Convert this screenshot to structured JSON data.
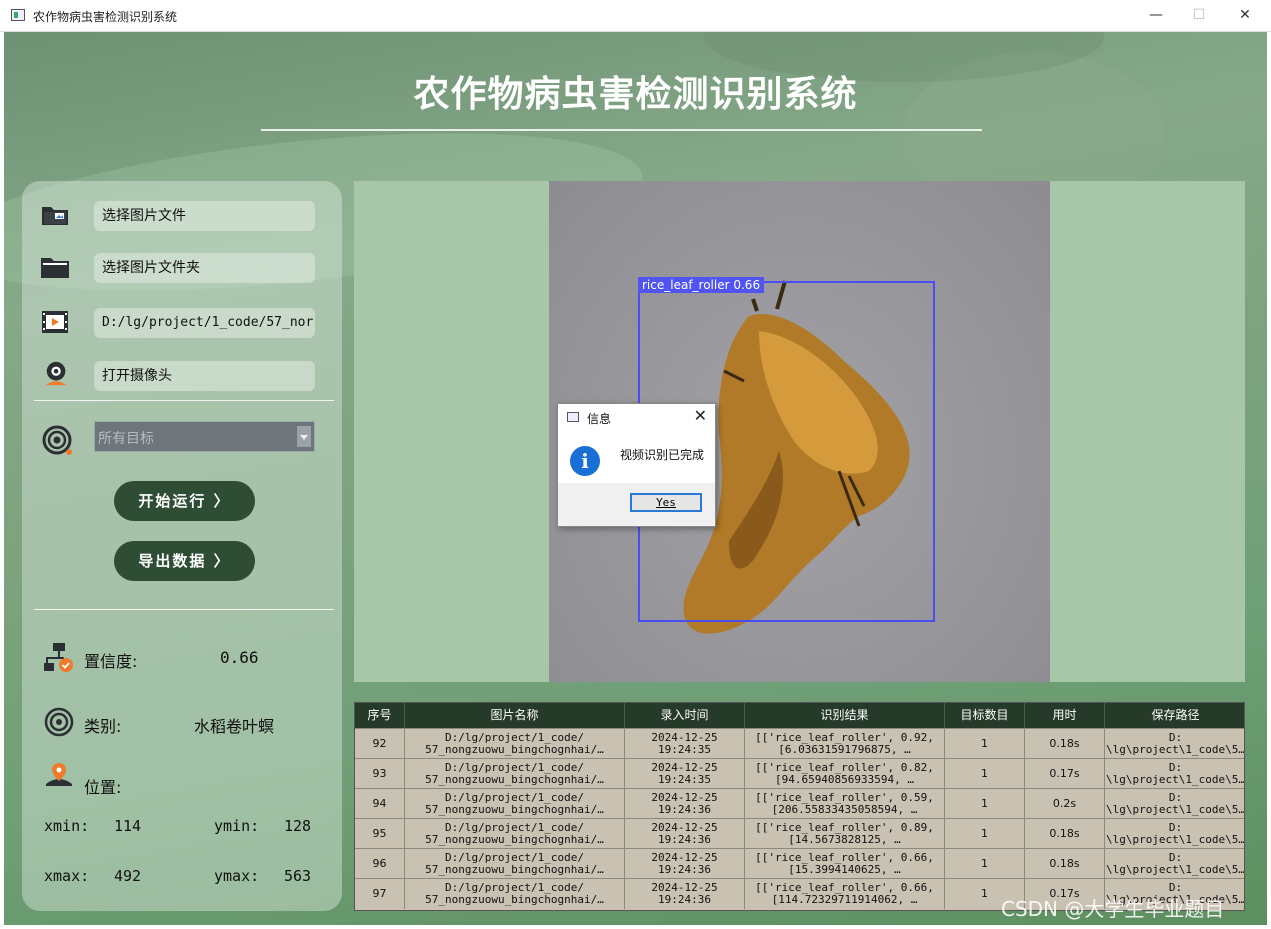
{
  "window": {
    "title": "农作物病虫害检测识别系统",
    "minimize": "—",
    "maximize": "☐",
    "close": "✕"
  },
  "header": {
    "title": "农作物病虫害检测识别系统"
  },
  "sidebar": {
    "select_image": "选择图片文件",
    "select_folder": "选择图片文件夹",
    "video_path": "D:/lg/project/1_code/57_nor",
    "open_camera": "打开摄像头",
    "target_select": "所有目标",
    "start_button": "开始运行 〉",
    "export_button": "导出数据 〉"
  },
  "info": {
    "confidence_label": "置信度:",
    "confidence_value": "0.66",
    "class_label": "类别:",
    "class_value": "水稻卷叶螟",
    "position_label": "位置:",
    "xmin_label": "xmin:",
    "xmin_value": "114",
    "ymin_label": "ymin:",
    "ymin_value": "128",
    "xmax_label": "xmax:",
    "xmax_value": "492",
    "ymax_label": "ymax:",
    "ymax_value": "563"
  },
  "detection": {
    "label": "rice_leaf_roller 0.66",
    "box_color": "#4a4ef0"
  },
  "dialog": {
    "title": "信息",
    "close": "✕",
    "icon": "i",
    "message": "视频识别已完成",
    "yes_button": "Yes"
  },
  "table": {
    "headers": [
      "序号",
      "图片名称",
      "录入时间",
      "识别结果",
      "目标数目",
      "用时",
      "保存路径"
    ],
    "rows": [
      {
        "id": "92",
        "name1": "D:/lg/project/1_code/",
        "name2": "57_nongzuowu_bingchognhai/…",
        "date": "2024-12-25",
        "time": "19:24:35",
        "res1": "[['rice_leaf_roller', 0.92,",
        "res2": "[6.03631591796875,  …",
        "count": "1",
        "dur": "0.18s",
        "path1": "D:",
        "path2": "\\lg\\project\\1_code\\5…"
      },
      {
        "id": "93",
        "name1": "D:/lg/project/1_code/",
        "name2": "57_nongzuowu_bingchognhai/…",
        "date": "2024-12-25",
        "time": "19:24:35",
        "res1": "[['rice_leaf_roller', 0.82,",
        "res2": "[94.65940856933594,  …",
        "count": "1",
        "dur": "0.17s",
        "path1": "D:",
        "path2": "\\lg\\project\\1_code\\5…"
      },
      {
        "id": "94",
        "name1": "D:/lg/project/1_code/",
        "name2": "57_nongzuowu_bingchognhai/…",
        "date": "2024-12-25",
        "time": "19:24:36",
        "res1": "[['rice_leaf_roller', 0.59,",
        "res2": "[206.55833435058594,  …",
        "count": "1",
        "dur": "0.2s",
        "path1": "D:",
        "path2": "\\lg\\project\\1_code\\5…"
      },
      {
        "id": "95",
        "name1": "D:/lg/project/1_code/",
        "name2": "57_nongzuowu_bingchognhai/…",
        "date": "2024-12-25",
        "time": "19:24:36",
        "res1": "[['rice_leaf_roller', 0.89,",
        "res2": "[14.5673828125,  …",
        "count": "1",
        "dur": "0.18s",
        "path1": "D:",
        "path2": "\\lg\\project\\1_code\\5…"
      },
      {
        "id": "96",
        "name1": "D:/lg/project/1_code/",
        "name2": "57_nongzuowu_bingchognhai/…",
        "date": "2024-12-25",
        "time": "19:24:36",
        "res1": "[['rice_leaf_roller', 0.66,",
        "res2": "[15.3994140625,  …",
        "count": "1",
        "dur": "0.18s",
        "path1": "D:",
        "path2": "\\lg\\project\\1_code\\5…"
      },
      {
        "id": "97",
        "name1": "D:/lg/project/1_code/",
        "name2": "57_nongzuowu_bingchognhai/…",
        "date": "2024-12-25",
        "time": "19:24:36",
        "res1": "[['rice_leaf_roller', 0.66,",
        "res2": "[114.72329711914062,  …",
        "count": "1",
        "dur": "0.17s",
        "path1": "D:",
        "path2": "\\lg\\project\\1_code\\5…"
      }
    ]
  },
  "watermark": "CSDN @大学生毕业题目"
}
